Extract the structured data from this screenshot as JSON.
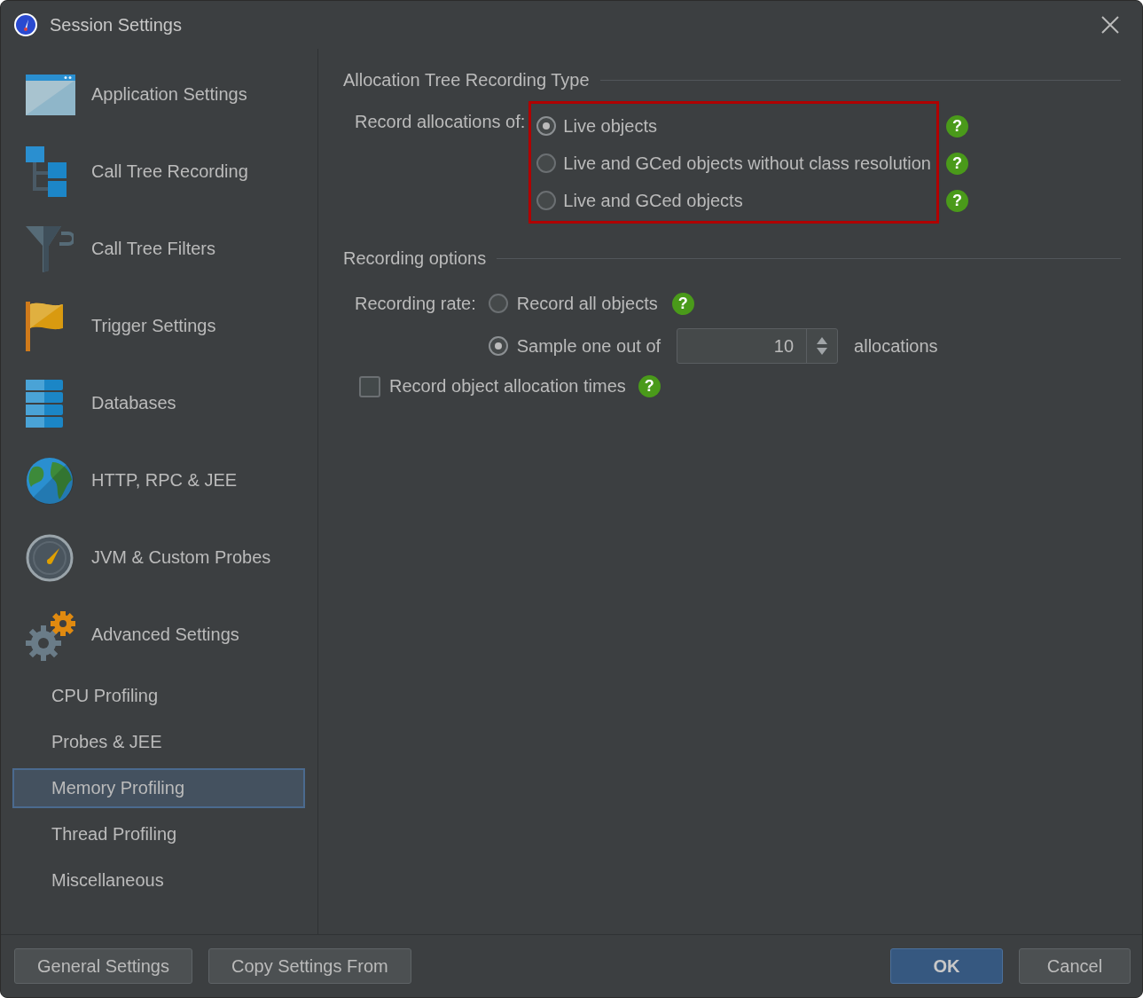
{
  "window": {
    "title": "Session Settings"
  },
  "sidebar": {
    "items": [
      {
        "label": "Application Settings",
        "kind": "main",
        "selected": false
      },
      {
        "label": "Call Tree Recording",
        "kind": "main",
        "selected": false
      },
      {
        "label": "Call Tree Filters",
        "kind": "main",
        "selected": false
      },
      {
        "label": "Trigger Settings",
        "kind": "main",
        "selected": false
      },
      {
        "label": "Databases",
        "kind": "main",
        "selected": false
      },
      {
        "label": "HTTP, RPC & JEE",
        "kind": "main",
        "selected": false
      },
      {
        "label": "JVM & Custom Probes",
        "kind": "main",
        "selected": false
      },
      {
        "label": "Advanced Settings",
        "kind": "main",
        "selected": false
      },
      {
        "label": "CPU Profiling",
        "kind": "sub",
        "selected": false
      },
      {
        "label": "Probes & JEE",
        "kind": "sub",
        "selected": false
      },
      {
        "label": "Memory Profiling",
        "kind": "sub",
        "selected": true
      },
      {
        "label": "Thread Profiling",
        "kind": "sub",
        "selected": false
      },
      {
        "label": "Miscellaneous",
        "kind": "sub",
        "selected": false
      }
    ]
  },
  "allocation_type": {
    "title": "Allocation Tree Recording Type",
    "label": "Record allocations of:",
    "highlighted": true,
    "options": [
      {
        "label": "Live objects",
        "selected": true,
        "help": "?"
      },
      {
        "label": "Live and GCed objects without class resolution",
        "selected": false,
        "help": "?"
      },
      {
        "label": "Live and GCed objects",
        "selected": false,
        "help": "?"
      }
    ]
  },
  "recording_options": {
    "title": "Recording options",
    "rate_label": "Recording rate:",
    "rate_options": [
      {
        "kind": "plain",
        "label": "Record all objects",
        "selected": false,
        "help": "?"
      },
      {
        "kind": "spinner",
        "label": "Sample one out of",
        "selected": true,
        "value": "10",
        "suffix": "allocations"
      }
    ],
    "checkbox": {
      "label": "Record object allocation times",
      "checked": false,
      "help": "?"
    }
  },
  "left_buttons": [
    {
      "label": "General Settings",
      "default": false
    },
    {
      "label": "Copy Settings From",
      "default": false
    }
  ],
  "right_buttons": [
    {
      "label": "OK",
      "default": true
    },
    {
      "label": "Cancel",
      "default": false
    }
  ]
}
